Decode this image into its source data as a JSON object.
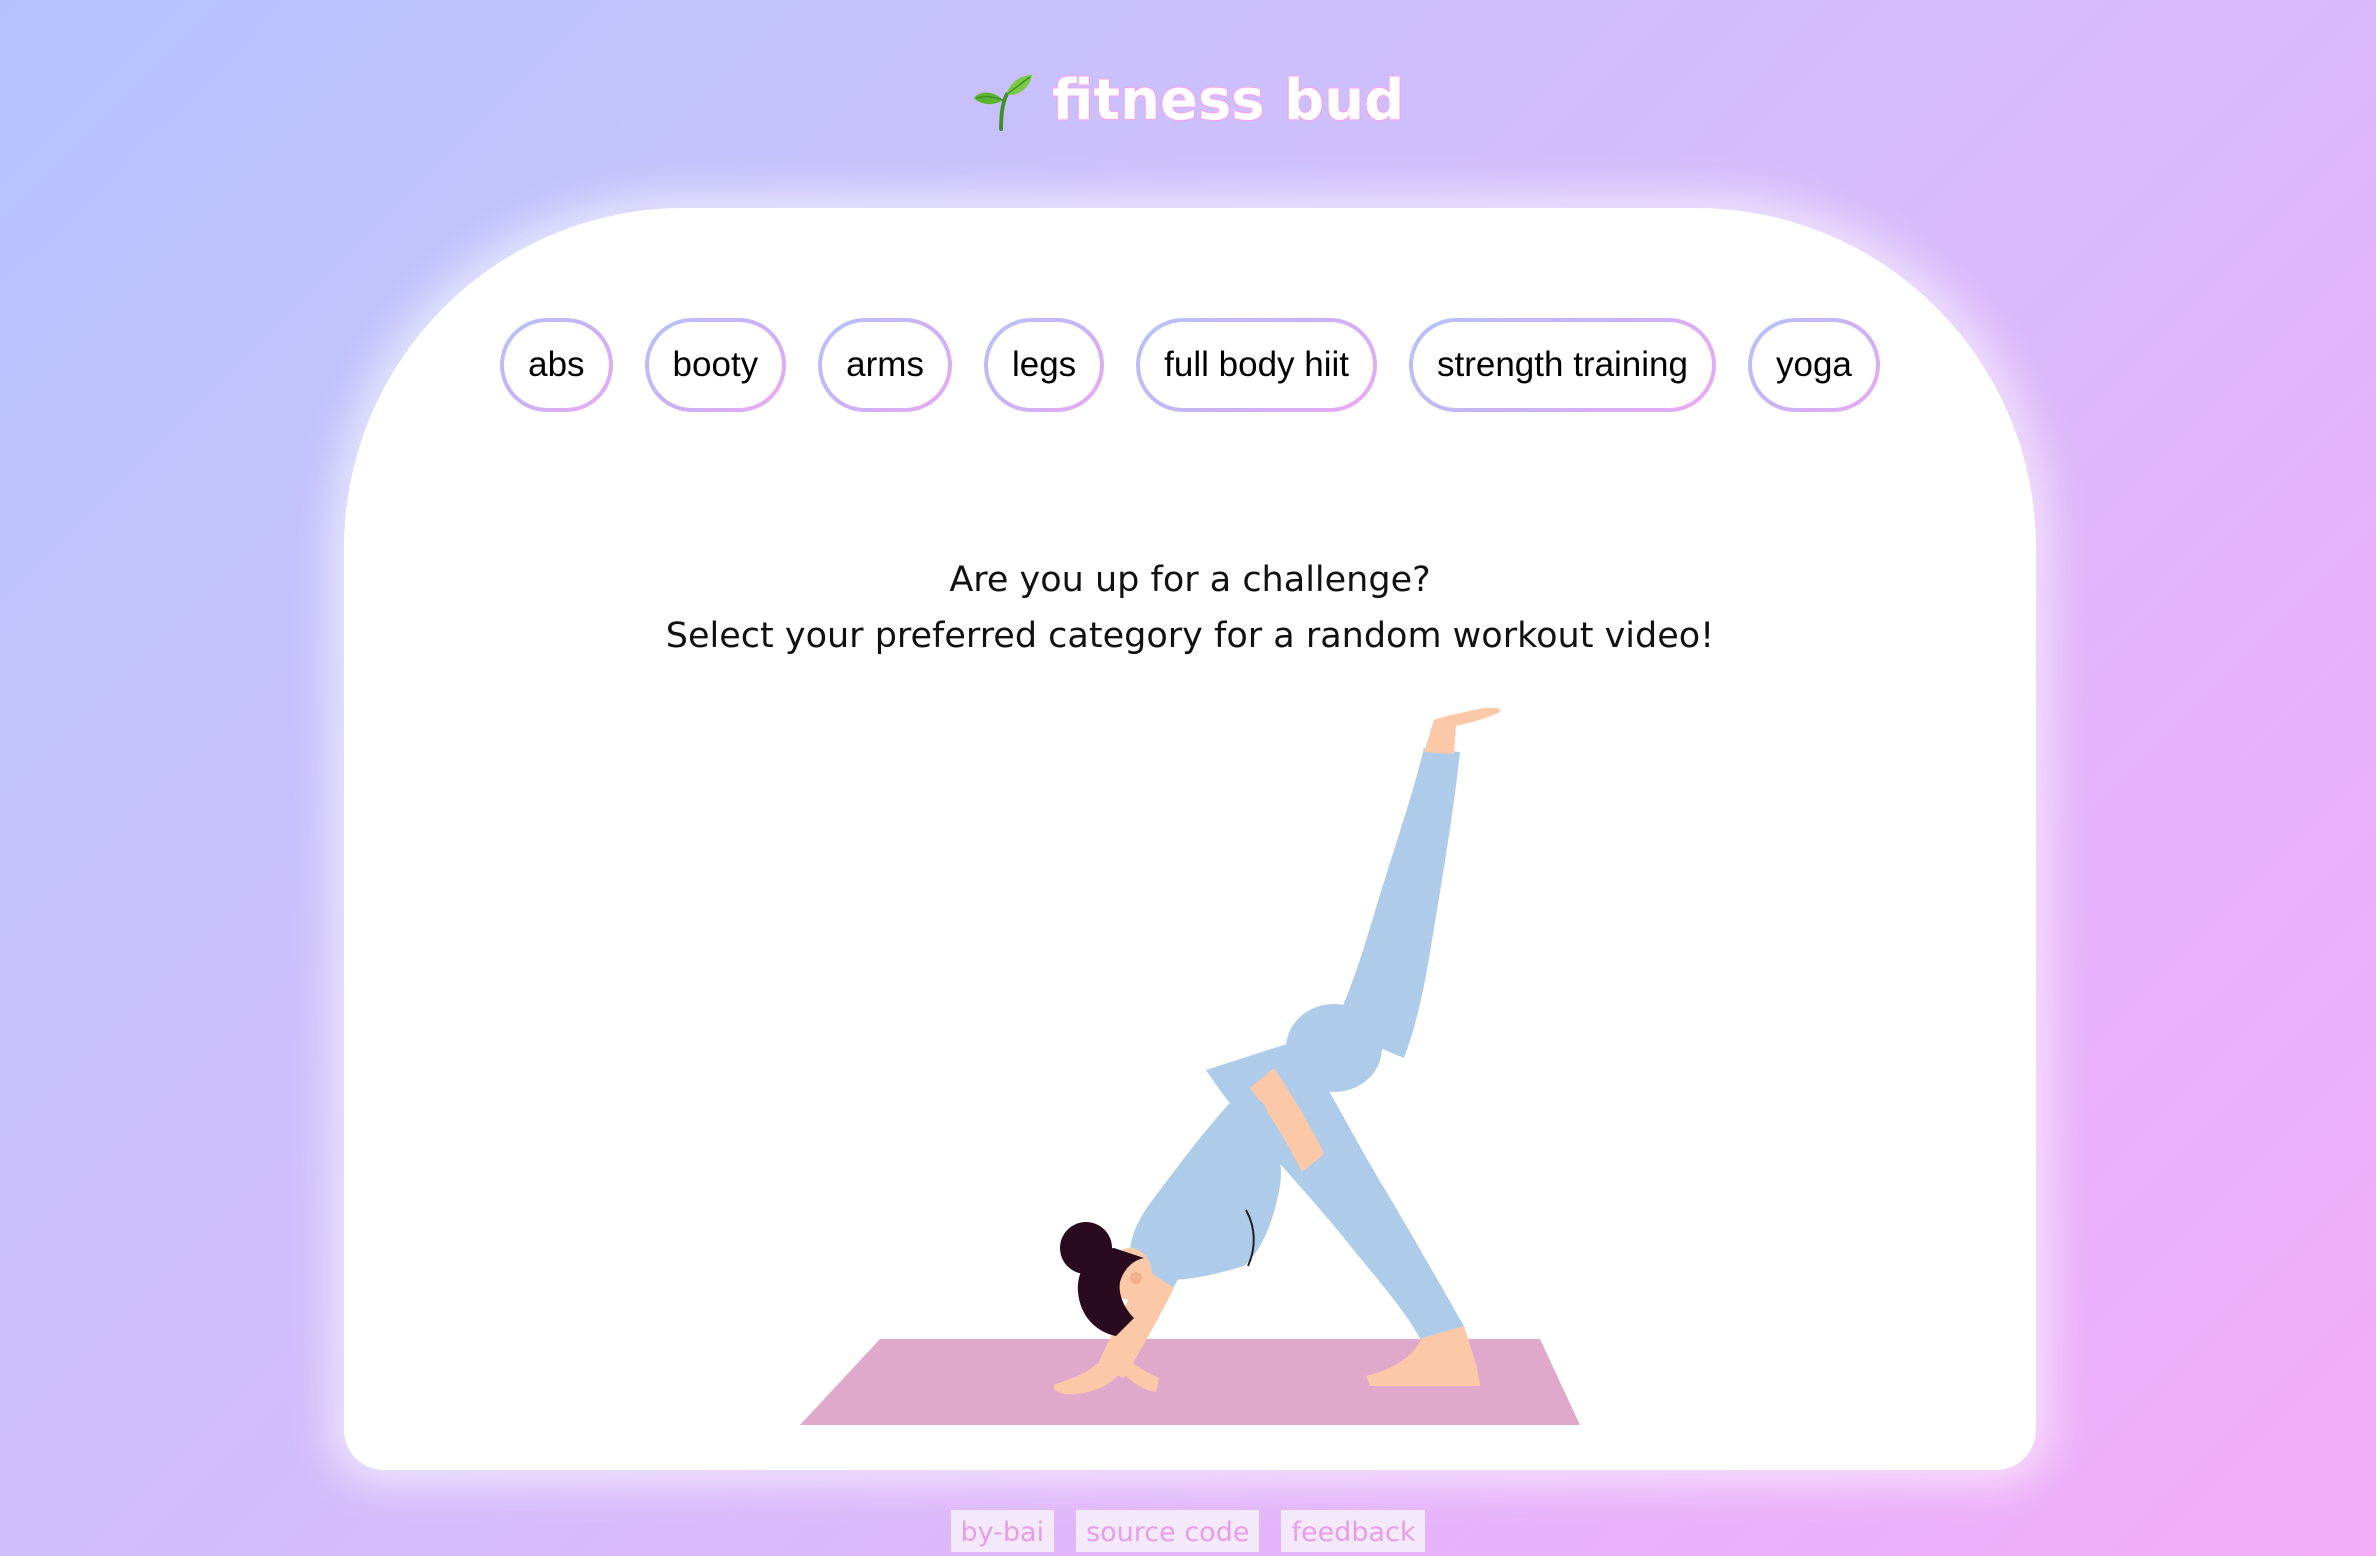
{
  "app": {
    "title": "fitness bud",
    "logo_icon": "seedling-icon"
  },
  "categories": [
    {
      "label": "abs"
    },
    {
      "label": "booty"
    },
    {
      "label": "arms"
    },
    {
      "label": "legs"
    },
    {
      "label": "full body hiit"
    },
    {
      "label": "strength training"
    },
    {
      "label": "yoga"
    }
  ],
  "prompt": {
    "line1": "Are you up for a challenge?",
    "line2": "Select your preferred category for a random workout video!"
  },
  "illustration": {
    "icon": "yoga-pose-illustration"
  },
  "footer": {
    "links": [
      {
        "label": "by-bai"
      },
      {
        "label": "source code"
      },
      {
        "label": "feedback"
      }
    ]
  },
  "colors": {
    "background_start": "#b3c4fd",
    "background_end": "#f4adf9",
    "card": "#ffffff",
    "button_border_start": "#b6c3f8",
    "button_border_end": "#eca8f3",
    "footer_text": "#e79ee8",
    "mat": "#e0a9cc",
    "clothing": "#aecbea",
    "skin": "#fbc9a7",
    "hair": "#2a0a1e"
  }
}
